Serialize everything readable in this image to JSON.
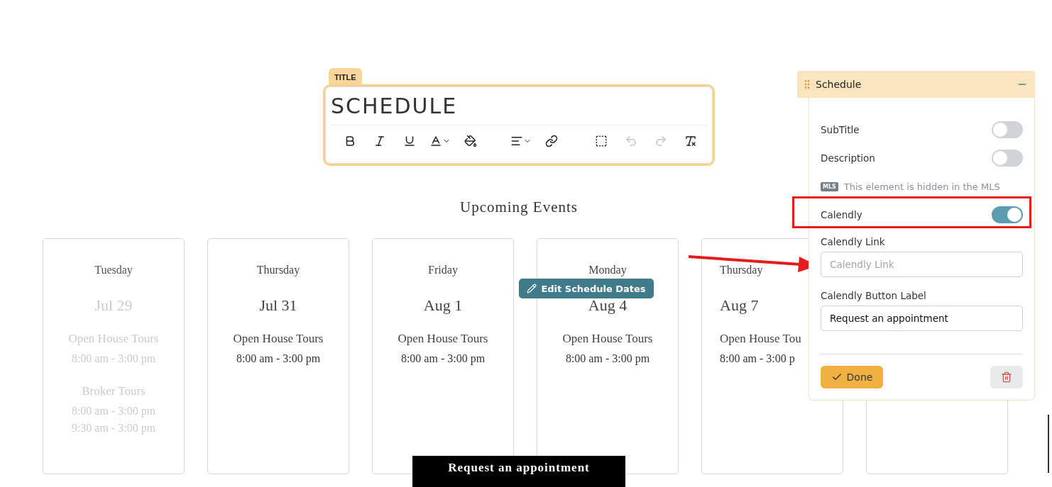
{
  "title_editor": {
    "tab": "TITLE",
    "text": "SCHEDULE",
    "toolbar": [
      [
        {
          "kind": "bold",
          "disabled": false
        },
        {
          "kind": "italic",
          "disabled": false
        },
        {
          "kind": "underline",
          "disabled": false
        },
        {
          "kind": "highlight",
          "disabled": false
        },
        {
          "kind": "color",
          "disabled": false
        }
      ],
      [
        {
          "kind": "align",
          "disabled": false
        },
        {
          "kind": "link",
          "disabled": false
        }
      ],
      [
        {
          "kind": "select",
          "disabled": false
        },
        {
          "kind": "undo",
          "disabled": true
        },
        {
          "kind": "redo",
          "disabled": true
        },
        {
          "kind": "clear",
          "disabled": false
        }
      ]
    ]
  },
  "heading": "Upcoming Events",
  "edit_button": "Edit Schedule Dates",
  "days": [
    {
      "kind": "day",
      "day": "Tuesday",
      "date": "Jul 29",
      "past": true,
      "cut": false,
      "events": [
        {
          "name": "Open House Tours",
          "times": [
            "8:00 am - 3:00 pm"
          ]
        },
        {
          "name": "Broker Tours",
          "times": [
            "8:00 am - 3:00 pm",
            "9:30 am - 3:00 pm"
          ]
        }
      ]
    },
    {
      "kind": "day",
      "day": "Thursday",
      "date": "Jul 31",
      "past": false,
      "cut": false,
      "events": [
        {
          "name": "Open House Tours",
          "times": [
            "8:00 am - 3:00 pm"
          ]
        }
      ]
    },
    {
      "kind": "day",
      "day": "Friday",
      "date": "Aug 1",
      "past": false,
      "cut": false,
      "events": [
        {
          "name": "Open House Tours",
          "times": [
            "8:00 am - 3:00 pm"
          ]
        }
      ]
    },
    {
      "kind": "day",
      "day": "Monday",
      "date": "Aug 4",
      "past": false,
      "cut": false,
      "events": [
        {
          "name": "Open House Tours",
          "times": [
            "8:00 am - 3:00 pm"
          ]
        }
      ]
    },
    {
      "kind": "day",
      "day": "Thursday",
      "date": "Aug 7",
      "past": false,
      "cut": true,
      "events": [
        {
          "name": "Open House Tou",
          "times": [
            "8:00 am - 3:00 p"
          ]
        }
      ]
    },
    {
      "kind": "covered"
    }
  ],
  "appointment_button": "Request an appointment",
  "panel": {
    "title": "Schedule",
    "toggles": [
      {
        "label": "SubTitle",
        "on": false
      },
      {
        "label": "Description",
        "on": false
      }
    ],
    "mls_badge": "MLS",
    "mls_note": "This element is hidden in the MLS",
    "calendly": {
      "label": "Calendly",
      "on": true
    },
    "fields": [
      {
        "label": "Calendly Link",
        "placeholder": "Calendly Link"
      },
      {
        "label": "Calendly Button Label",
        "value": "Request an appointment"
      }
    ],
    "done": "Done"
  }
}
